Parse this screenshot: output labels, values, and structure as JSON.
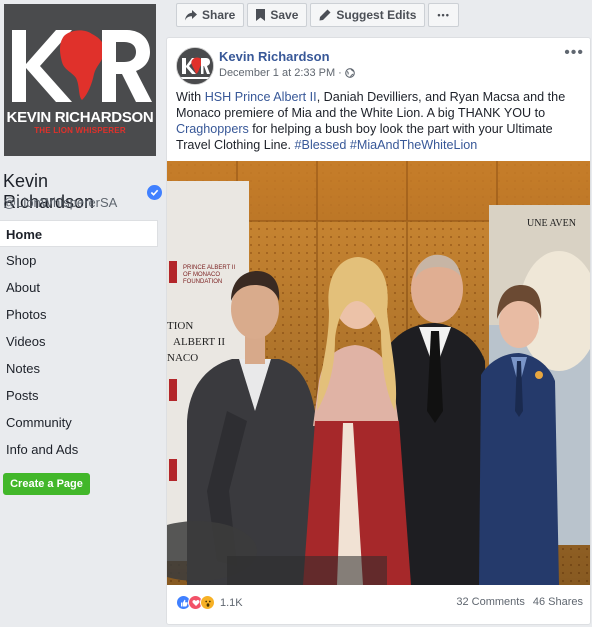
{
  "logo": {
    "name": "KEVIN RICHARDSON",
    "tagline": "THE LION WHISPERER"
  },
  "page": {
    "name": "Kevin Richardson",
    "handle": "@LionWhispererSA"
  },
  "nav": {
    "items": [
      {
        "label": "Home"
      },
      {
        "label": "Shop"
      },
      {
        "label": "About"
      },
      {
        "label": "Photos"
      },
      {
        "label": "Videos"
      },
      {
        "label": "Notes"
      },
      {
        "label": "Posts"
      },
      {
        "label": "Community"
      },
      {
        "label": "Info and Ads"
      }
    ],
    "create_page": "Create a Page"
  },
  "toolbar": {
    "share": "Share",
    "save": "Save",
    "suggest": "Suggest Edits",
    "more": "•••"
  },
  "post": {
    "author": "Kevin Richardson",
    "timestamp": "December 1 at 2:33 PM",
    "meta_sep": "·",
    "text_1": "With ",
    "link_1": "HSH Prince Albert II",
    "text_2": ", Daniah Devilliers, and Ryan Macsa and the Monaco premiere of Mia and the White Lion. A big THANK YOU to ",
    "link_2": "Craghoppers",
    "text_3": " for helping a bush boy look the part with your Ultimate Travel Clothing Line. ",
    "hashtag_1": "#Blessed",
    "text_4": " ",
    "hashtag_2": "#MiaAndTheWhiteLion",
    "banner_left_1": "PRINCE ALBERT II",
    "banner_left_2": "OF MONACO",
    "banner_left_3": "FOUNDATION",
    "banner_left_4": "TION",
    "banner_left_5": "ALBERT II",
    "banner_left_6": "NACO",
    "poster_text": "UNE AVEN"
  },
  "footer": {
    "reaction_count": "1.1K",
    "comments": "32 Comments",
    "shares": "46 Shares"
  },
  "colors": {
    "link": "#385898",
    "create_button": "#42b72a",
    "verified": "#4080ff",
    "logo_red": "#e0312b"
  }
}
